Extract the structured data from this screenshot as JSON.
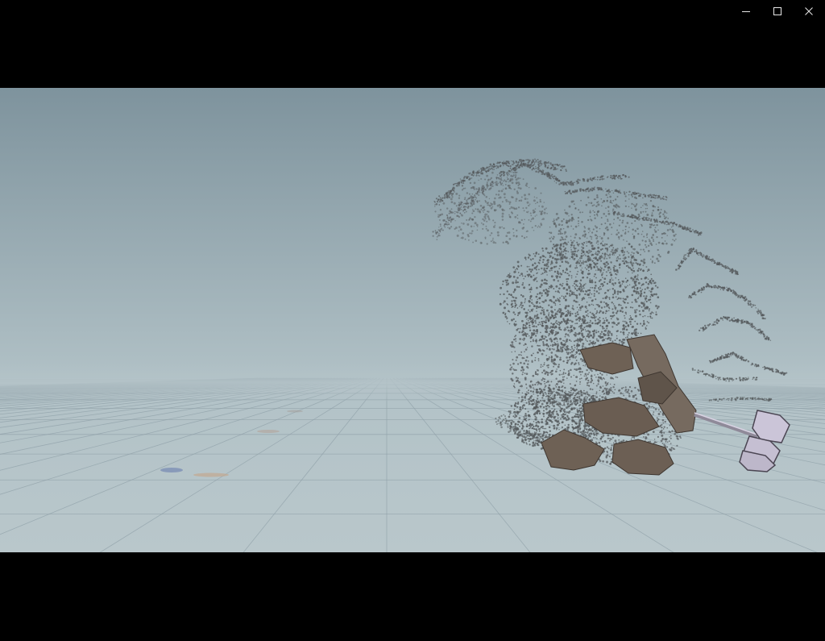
{
  "window": {
    "controls": [
      {
        "name": "minimize-icon",
        "action": "minimize"
      },
      {
        "name": "maximize-icon",
        "action": "maximize"
      },
      {
        "name": "close-icon",
        "action": "close"
      }
    ]
  },
  "scene": {
    "sky_top_color": "#7e939d",
    "sky_horizon_color": "#b2c2c7",
    "ground_color": "#b9c7cb",
    "grid_line_color": "#8fa0a8",
    "particle_color": "#555a5c",
    "rock_color": "#6e6155",
    "hammer_color": "#c9c3d6"
  }
}
